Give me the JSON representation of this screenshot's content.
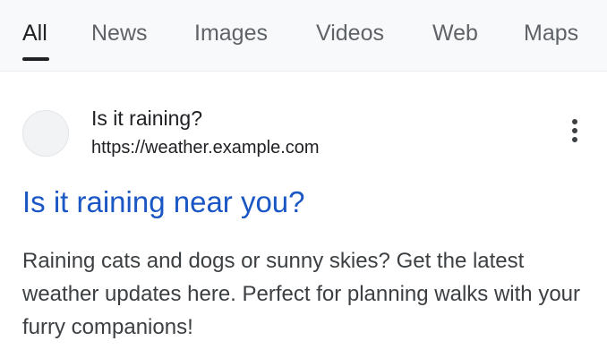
{
  "tabs": [
    {
      "label": "All",
      "active": true
    },
    {
      "label": "News"
    },
    {
      "label": "Images"
    },
    {
      "label": "Videos"
    },
    {
      "label": "Web"
    },
    {
      "label": "Maps"
    }
  ],
  "result": {
    "site_name": "Is it raining?",
    "url": "https://weather.example.com",
    "title": "Is it raining near you?",
    "snippet": "Raining cats and dogs or sunny skies? Get the latest weather updates here. Perfect for planning walks with your furry companions!",
    "menu_icon": "more-vert-icon"
  },
  "colors": {
    "link": "#1a56c4",
    "tab_bar_bg": "#f8f9fa",
    "active_tab": "#202124",
    "inactive_tab": "#5f6368"
  }
}
